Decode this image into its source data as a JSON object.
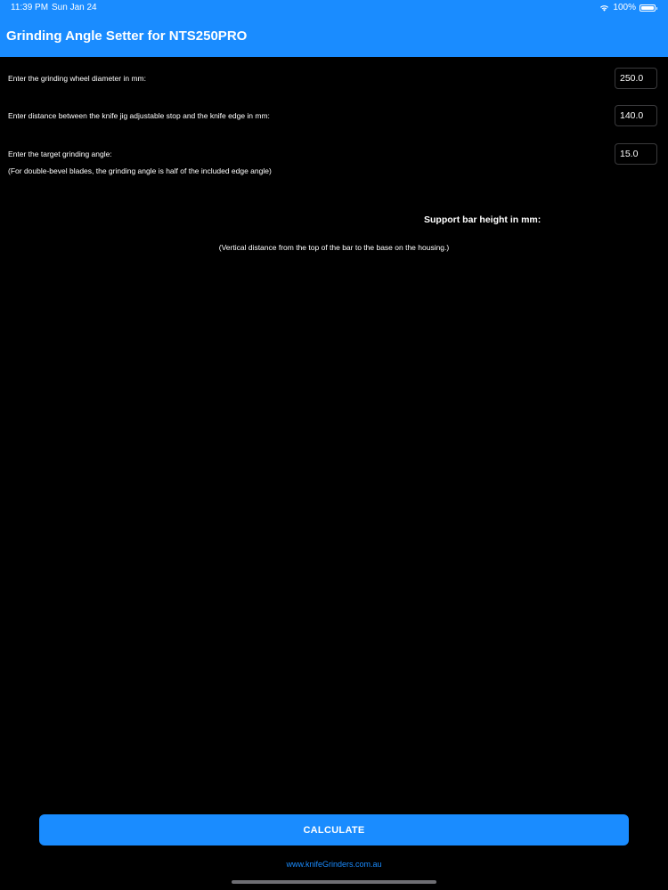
{
  "status_bar": {
    "time": "11:39 PM",
    "date": "Sun Jan 24",
    "battery": "100%",
    "battery_level": 1.0
  },
  "nav": {
    "title": "Grinding Angle Setter for NTS250PRO"
  },
  "form": {
    "wheel_diameter": {
      "label": "Enter the grinding wheel diameter in mm:",
      "value": "250.0"
    },
    "distance": {
      "label": "Enter distance between the knife jig adjustable stop and the knife edge in mm:",
      "value": "140.0"
    },
    "angle": {
      "label": "Enter the target grinding angle:",
      "note": "(For double-bevel blades, the grinding angle is half of the included edge angle)",
      "value": "15.0"
    }
  },
  "result": {
    "label": "Support bar height in mm:",
    "note": "(Vertical distance from the top of the bar to the base on the housing.)"
  },
  "actions": {
    "calculate_label": "CALCULATE"
  },
  "footer": {
    "link_text": "www.knifeGrinders.com.au"
  },
  "colors": {
    "accent": "#1a8cff",
    "background": "#000000",
    "text": "#ffffff",
    "input_border": "#3a3a3c"
  },
  "icons": [
    "wifi-icon",
    "battery-icon"
  ]
}
